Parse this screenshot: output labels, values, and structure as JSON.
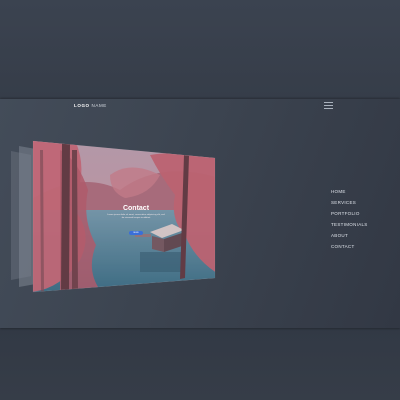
{
  "header": {
    "logo_bold": "LOGO",
    "logo_rest": " NAME"
  },
  "icons": {
    "menu": "hamburger-icon"
  },
  "nav": {
    "items": [
      "HOME",
      "SERVICES",
      "PORTFOLIO",
      "TESTIMONIALS",
      "ABOUT",
      "CONTACT"
    ]
  },
  "preview": {
    "title": "Contact",
    "text": "Lorem ipsum dolor sit amet, consectetur adipiscing elit, sed do eiusmod tempor incididunt",
    "button_label": "SEND"
  },
  "colors": {
    "background": "#353c47",
    "stage": "#3c4450",
    "accent": "#3a6fd8",
    "foliage": "#c86a78",
    "water": "#3d7c92"
  }
}
